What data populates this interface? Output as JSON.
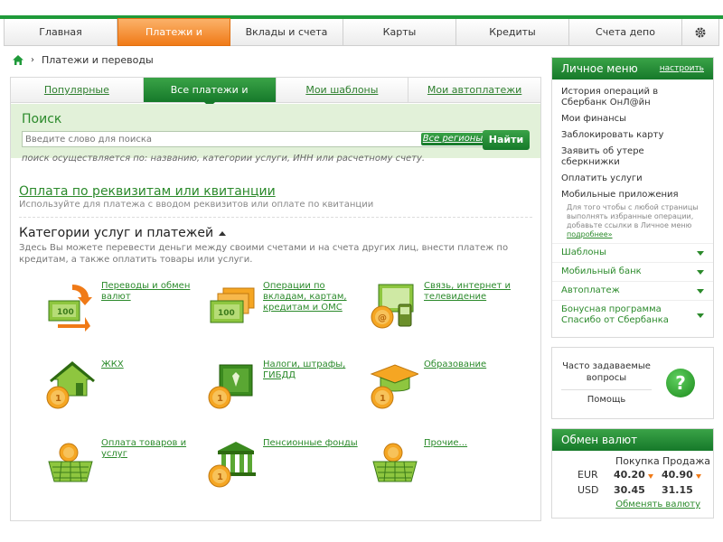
{
  "nav": {
    "items": [
      "Главная",
      "Платежи и переводы",
      "Вклады и счета",
      "Карты",
      "Кредиты",
      "Счета депо"
    ],
    "active_index": 1
  },
  "breadcrumb": {
    "current": "Платежи и переводы"
  },
  "tabs": [
    "Популярные",
    "Все платежи и переводы",
    "Мои шаблоны",
    "Мои автоплатежи"
  ],
  "search": {
    "title": "Поиск",
    "placeholder": "Введите слово для поиска",
    "regions": "Все регионы",
    "button": "Найти",
    "hint": "поиск осуществляется по: названию, категории услуги, ИНН или расчетному счету."
  },
  "requisites": {
    "link": "Оплата по реквизитам или квитанции",
    "subtitle": "Используйте для платежа с вводом реквизитов или оплате по квитанции"
  },
  "categories": {
    "title": "Категории услуг и платежей",
    "description": "Здесь Вы можете перевести деньги между своими счетами и на счета других лиц, внести платеж по кредитам, а также оплатить товары или услуги.",
    "items": [
      {
        "label": "Переводы и обмен валют",
        "icon": "money-transfer-icon"
      },
      {
        "label": "Операции по вкладам, картам, кредитам и ОМС",
        "icon": "banknotes-icon"
      },
      {
        "label": "Связь, интернет и телевидение",
        "icon": "telecom-icon"
      },
      {
        "label": "ЖКХ",
        "icon": "house-icon"
      },
      {
        "label": "Налоги, штрафы, ГИБДД",
        "icon": "emblem-document-icon"
      },
      {
        "label": "Образование",
        "icon": "graduation-cap-icon"
      },
      {
        "label": "Оплата товаров и услуг",
        "icon": "shopping-basket-icon"
      },
      {
        "label": "Пенсионные фонды",
        "icon": "bank-building-icon"
      },
      {
        "label": "Прочие...",
        "icon": "basket-other-icon"
      }
    ]
  },
  "personal_menu": {
    "title": "Личное меню",
    "configure": "настроить",
    "items": [
      "История операций в Сбербанк ОнЛ@йн",
      "Мои финансы",
      "Заблокировать карту",
      "Заявить об утере сберкнижки",
      "Оплатить услуги",
      "Мобильные приложения"
    ],
    "note": "Для того чтобы с любой страницы выполнять избранные операции, добавьте ссылки в Личное меню",
    "note_more": "подробнее»",
    "accordions": [
      "Шаблоны",
      "Мобильный банк",
      "Автоплатеж",
      "Бонусная программа Спасибо от Сбербанка"
    ]
  },
  "faq": {
    "title": "Часто задаваемые вопросы",
    "help": "Помощь"
  },
  "fx": {
    "title": "Обмен валют",
    "buy_label": "Покупка",
    "sell_label": "Продажа",
    "rows": [
      {
        "currency": "EUR",
        "buy": "40.20",
        "sell": "40.90",
        "buy_down": true,
        "sell_down": true
      },
      {
        "currency": "USD",
        "buy": "30.45",
        "sell": "31.15",
        "buy_down": false,
        "sell_down": false
      }
    ],
    "exchange_link": "Обменять валюту"
  },
  "colors": {
    "brand_green": "#1f9a3a",
    "active_orange": "#f07a17"
  }
}
